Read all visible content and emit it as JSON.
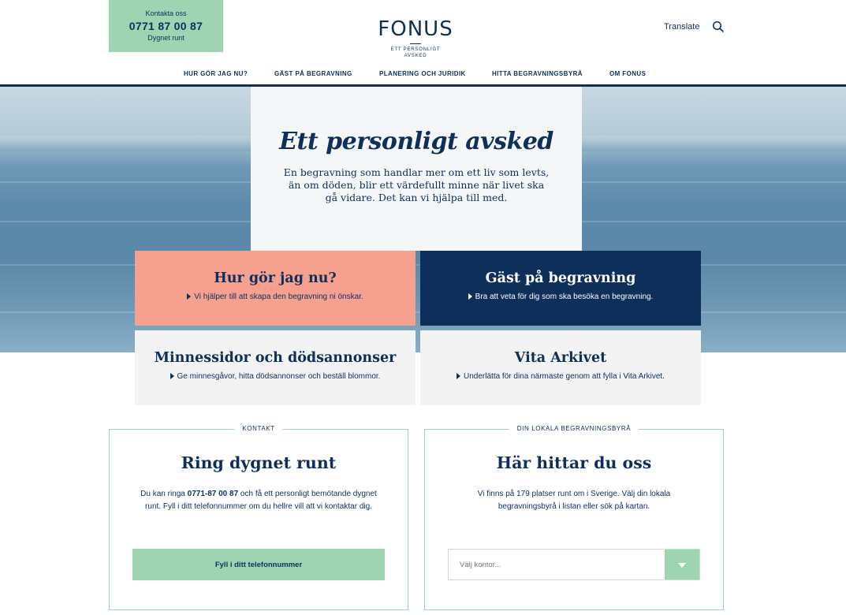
{
  "header": {
    "contact_label": "Kontakta oss",
    "contact_phone": "0771 87 00 87",
    "contact_sub": "Dygnet runt",
    "logo_word": "FONUS",
    "logo_tagline": "ETT PERSONLIGT AVSKED",
    "translate_label": "Translate",
    "search_icon": "search-icon"
  },
  "nav": {
    "items": [
      {
        "label": "HUR GÖR JAG NU?"
      },
      {
        "label": "GÄST PÅ BEGRAVNING"
      },
      {
        "label": "PLANERING OCH JURIDIK"
      },
      {
        "label": "HITTA BEGRAVNINGSBYRÅ"
      },
      {
        "label": "OM FONUS"
      }
    ]
  },
  "hero": {
    "title": "Ett personligt avsked",
    "text": "En begravning som handlar mer om ett liv som levts, än om döden, blir ett värdefullt minne när livet ska gå vidare. Det kan vi hjälpa till med."
  },
  "cards": [
    {
      "title": "Hur gör jag nu?",
      "sub": "Vi hjälper till att skapa den begravning ni önskar."
    },
    {
      "title": "Gäst på begravning",
      "sub": "Bra att veta för dig som ska besöka en begravning."
    },
    {
      "title": "Minnessidor och dödsannonser",
      "sub": "Ge minnesgåvor, hitta dödsannonser och beställ blommor."
    },
    {
      "title": "Vita Arkivet",
      "sub": "Underlätta för dina närmaste genom att fylla i Vita Arkivet."
    }
  ],
  "contact_box": {
    "label": "KONTAKT",
    "title": "Ring dygnet runt",
    "text_before": "Du kan ringa ",
    "text_phone": "0771-87 00 87",
    "text_after": " och få ett personligt bemötande dygnet runt. Fyll i ditt telefonnummer om du hellre vill att vi kontaktar dig.",
    "button_label": "Fyll i ditt telefonnummer"
  },
  "local_box": {
    "label": "DIN LOKALA BEGRAVNINGSBYRÅ",
    "title": "Här hittar du oss",
    "text": "Vi finns på 179 platser runt om i Sverige. Välj din lokala begravningsbyrå i listan eller sök på kartan.",
    "select_placeholder": "Välj kontor..."
  },
  "colors": {
    "navy": "#0e2f5a",
    "mint": "#9ed4b2",
    "salmon": "#f6a08f",
    "light_gray": "#f3f3f3"
  }
}
